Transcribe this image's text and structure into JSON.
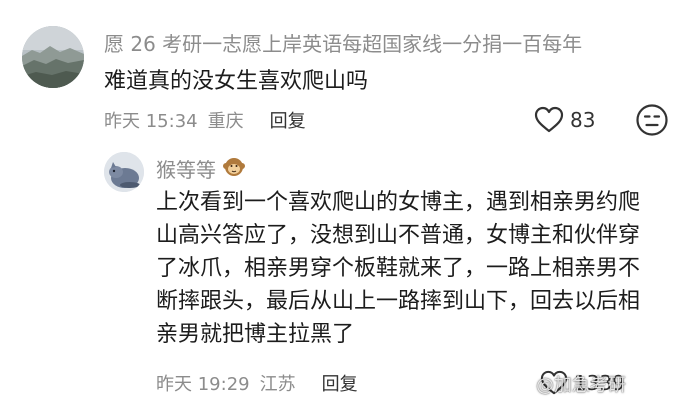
{
  "comment": {
    "username": "愿 26 考研一志愿上岸英语每超国家线一分捐一百每年",
    "text": "难道真的没女生喜欢爬山吗",
    "time": "昨天 15:34",
    "location": "重庆",
    "reply_label": "回复",
    "like_count": "83"
  },
  "reply": {
    "username": "猴等等",
    "text_lines": [
      "上次看到一个喜欢爬山的女博主，遇到相亲男约爬",
      "山高兴答应了，没想到山不普通，女博主和伙伴穿",
      "了冰爪，相亲男穿个板鞋就来了，一路上相亲男不",
      "断摔跟头，最后从山上一路摔到山下，回去以后相",
      "亲男就把博主拉黑了"
    ],
    "time": "昨天 19:29",
    "location": "江苏",
    "reply_label": "回复",
    "like_count": "1339"
  },
  "watermark": {
    "text": "@加急考研"
  },
  "icons": {
    "like": "heart-outline-icon",
    "dislike": "meh-face-icon",
    "monkey": "monkey-emoji-icon",
    "weibo": "weibo-logo-icon"
  }
}
